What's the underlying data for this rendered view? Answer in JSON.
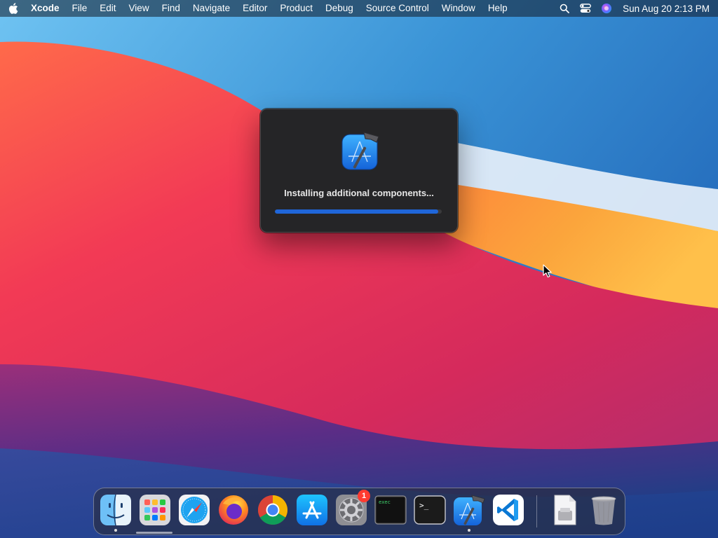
{
  "menubar": {
    "app_name": "Xcode",
    "menus": [
      "File",
      "Edit",
      "View",
      "Find",
      "Navigate",
      "Editor",
      "Product",
      "Debug",
      "Source Control",
      "Window",
      "Help"
    ],
    "clock": "Sun Aug 20  2:13 PM"
  },
  "dialog": {
    "message": "Installing additional components...",
    "progress_percent": 98,
    "accent_color": "#1f66d9"
  },
  "dock": {
    "items": [
      {
        "name": "finder",
        "running": true
      },
      {
        "name": "launchpad",
        "running": false
      },
      {
        "name": "safari",
        "running": false
      },
      {
        "name": "firefox",
        "running": false
      },
      {
        "name": "chrome",
        "running": false
      },
      {
        "name": "app-store",
        "running": false
      },
      {
        "name": "system-preferences",
        "running": false,
        "badge": "1"
      },
      {
        "name": "script-editor",
        "running": false
      },
      {
        "name": "terminal",
        "running": false
      },
      {
        "name": "xcode",
        "running": true
      },
      {
        "name": "vscode",
        "running": false
      },
      {
        "name": "file-archive",
        "running": false
      },
      {
        "name": "trash",
        "running": false
      }
    ],
    "terminal_prompt": ">_",
    "script_label": "exec"
  }
}
